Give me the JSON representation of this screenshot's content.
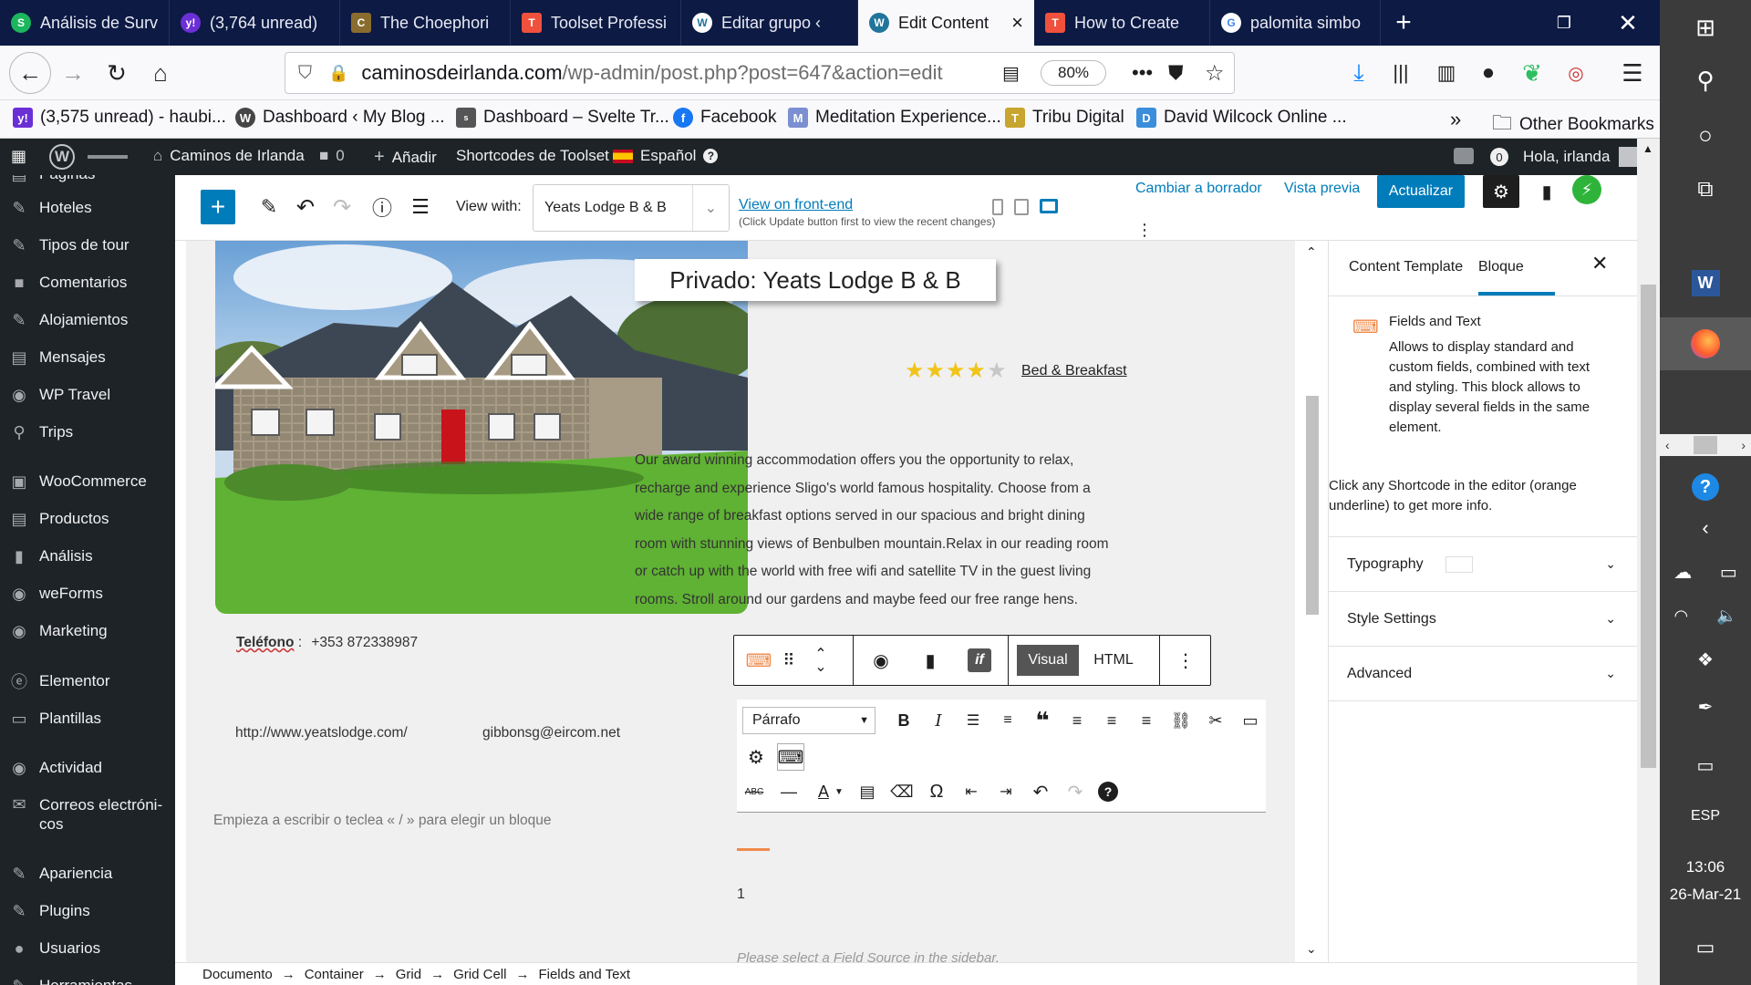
{
  "tabs": [
    {
      "title": "Análisis de Surv",
      "color": "#1bb65d",
      "glyph": "S"
    },
    {
      "title": "(3,764 unread)",
      "color": "#6b2fd6",
      "glyph": "y!"
    },
    {
      "title": "The Choephori",
      "color": "#8a6d2e",
      "glyph": "C"
    },
    {
      "title": "Toolset Professi",
      "color": "#f0513c",
      "glyph": "T"
    },
    {
      "title": "Editar grupo ‹",
      "color": "#21759b",
      "glyph": "W"
    },
    {
      "title": "Edit Content",
      "color": "#21759b",
      "glyph": "W"
    },
    {
      "title": "How to Create",
      "color": "#f0513c",
      "glyph": "T"
    },
    {
      "title": "palomita simbo",
      "color": "#4285f4",
      "glyph": "G"
    }
  ],
  "browser": {
    "url_domain": "caminosdeirlanda.com",
    "url_path": "/wp-admin/post.php?post=647&action=edit",
    "zoom": "80%"
  },
  "bookmarks": [
    {
      "label": "(3,575 unread) - haubi...",
      "color": "#6b2fd6",
      "glyph": "y!"
    },
    {
      "label": "Dashboard ‹ My Blog ...",
      "color": "#464646",
      "glyph": "W"
    },
    {
      "label": "Dashboard – Svelte Tr...",
      "color": "#555555",
      "glyph": "s"
    },
    {
      "label": "Facebook",
      "color": "#1877f2",
      "glyph": "f"
    },
    {
      "label": "Meditation Experience...",
      "color": "#7b8fd1",
      "glyph": "M"
    },
    {
      "label": "Tribu Digital",
      "color": "#c7a52e",
      "glyph": "T"
    },
    {
      "label": "David Wilcock Online ...",
      "color": "#3a8edb",
      "glyph": "D"
    },
    {
      "label": "Other Bookmarks",
      "color": "#777777",
      "glyph": "▭"
    }
  ],
  "adminbar": {
    "site": "Caminos de Irlanda",
    "comments": "0",
    "add": "Añadir",
    "shortcodes": "Shortcodes de Toolset",
    "language": "Español",
    "notif": "0",
    "greeting": "Hola, irlanda"
  },
  "menu": [
    {
      "label": "Páginas",
      "icon": "▤"
    },
    {
      "label": "Hoteles",
      "icon": "✎"
    },
    {
      "label": "Tipos de tour",
      "icon": "✎"
    },
    {
      "label": "Comentarios",
      "icon": "■"
    },
    {
      "label": "Alojamientos",
      "icon": "✎"
    },
    {
      "label": "Mensajes",
      "icon": "▤"
    },
    {
      "label": "WP Travel",
      "icon": "◉"
    },
    {
      "label": "Trips",
      "icon": "⚲"
    },
    {
      "label": "WooCommerce",
      "icon": "▣"
    },
    {
      "label": "Productos",
      "icon": "▤"
    },
    {
      "label": "Análisis",
      "icon": "▮"
    },
    {
      "label": "weForms",
      "icon": "◉"
    },
    {
      "label": "Marketing",
      "icon": "◉"
    },
    {
      "label": "Elementor",
      "icon": "ⓔ"
    },
    {
      "label": "Plantillas",
      "icon": "▭"
    },
    {
      "label": "Actividad",
      "icon": "◉"
    },
    {
      "label": "Correos electróni-cos",
      "icon": "✉"
    },
    {
      "label": "Apariencia",
      "icon": "✎"
    },
    {
      "label": "Plugins",
      "icon": "✎"
    },
    {
      "label": "Usuarios",
      "icon": "●"
    },
    {
      "label": "Herramientas",
      "icon": "✎"
    }
  ],
  "editor": {
    "view_with_label": "View with:",
    "view_with_value": "Yeats Lodge B & B",
    "front_end_link": "View on front-end",
    "front_end_note": "(Click Update button first to view the recent changes)",
    "draft": "Cambiar a borrador",
    "preview": "Vista previa",
    "update": "Actualizar"
  },
  "content": {
    "title": "Privado: Yeats Lodge B & B",
    "stars": 4,
    "star_max": 5,
    "category": "Bed & Breakfast",
    "description": "Our award winning accommodation offers you the opportunity to relax, recharge and experience Sligo's world famous hospitality. Choose from a wide range of breakfast options served in our spacious and bright dining room with stunning views of Benbulben mountain.Relax in our reading room or catch up with the world with free wifi and satellite TV in the guest living rooms. Stroll around our gardens and maybe feed our free range hens.",
    "phone_label": "Teléfono",
    "phone": "+353 872338987",
    "website": "http://www.yeatslodge.com/",
    "email": "gibbonsg@eircom.net",
    "placeholder": "Empieza a escribir o teclea « / » para elegir un bloque",
    "block_toolbar": {
      "visual": "Visual",
      "html": "HTML"
    },
    "format_select": "Párrafo",
    "number": "1",
    "field_source_note": "Please select a Field Source in the sidebar."
  },
  "panel": {
    "tabs": [
      "Content Template",
      "Bloque"
    ],
    "block_name": "Fields and Text",
    "block_desc": "Allows to display standard and custom fields, combined with text and styling. This block allows to display several fields in the same element.",
    "hint": "Click any Shortcode in the editor (orange underline) to get more info.",
    "sections": [
      "Typography",
      "Style Settings",
      "Advanced"
    ]
  },
  "breadcrumb": [
    "Documento",
    "Container",
    "Grid",
    "Grid Cell",
    "Fields and Text"
  ],
  "taskbar": {
    "lang": "ESP",
    "time": "13:06",
    "date": "26-Mar-21"
  },
  "colors": {
    "wp_admin": "#1d2327",
    "wp_blue": "#007cba",
    "tab_bg": "#0c1a44",
    "shortcode_orange": "#f08a4b"
  }
}
